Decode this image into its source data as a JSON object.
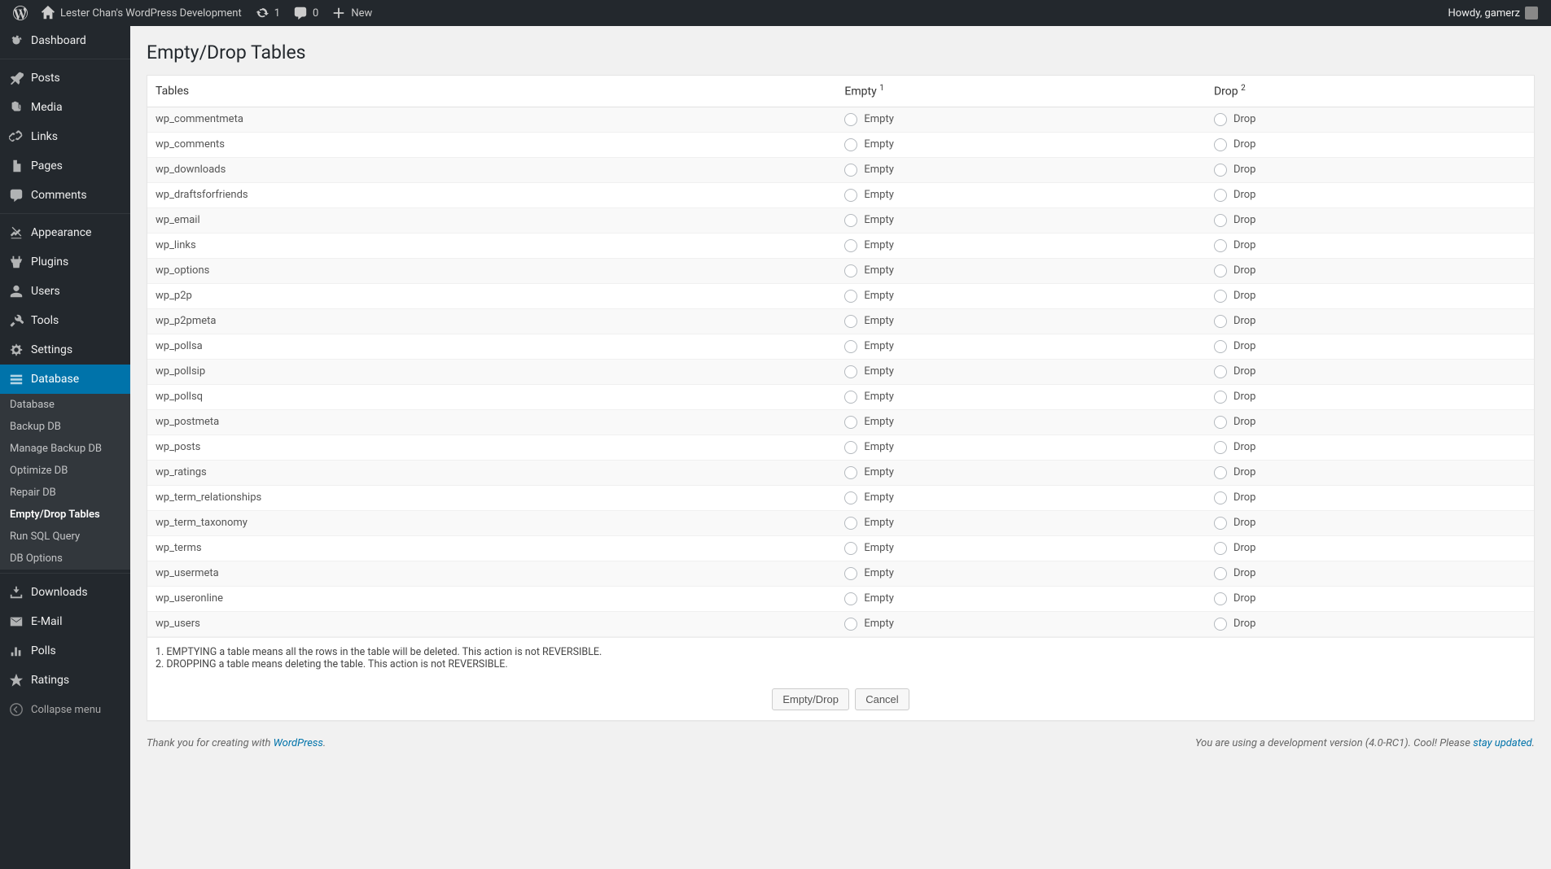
{
  "adminbar": {
    "site_title": "Lester Chan's WordPress Development",
    "updates_count": "1",
    "comments_count": "0",
    "new_label": "New",
    "howdy_label": "Howdy, gamerz"
  },
  "sidebar": {
    "items": [
      {
        "label": "Dashboard",
        "icon": "dashboard"
      },
      {
        "label": "Posts",
        "icon": "pin"
      },
      {
        "label": "Media",
        "icon": "media"
      },
      {
        "label": "Links",
        "icon": "link"
      },
      {
        "label": "Pages",
        "icon": "page"
      },
      {
        "label": "Comments",
        "icon": "comment"
      },
      {
        "label": "Appearance",
        "icon": "appearance"
      },
      {
        "label": "Plugins",
        "icon": "plugin"
      },
      {
        "label": "Users",
        "icon": "users"
      },
      {
        "label": "Tools",
        "icon": "tools"
      },
      {
        "label": "Settings",
        "icon": "settings"
      },
      {
        "label": "Database",
        "icon": "database",
        "current": true
      },
      {
        "label": "Downloads",
        "icon": "download"
      },
      {
        "label": "E-Mail",
        "icon": "email"
      },
      {
        "label": "Polls",
        "icon": "polls"
      },
      {
        "label": "Ratings",
        "icon": "ratings"
      }
    ],
    "submenu": [
      {
        "label": "Database"
      },
      {
        "label": "Backup DB"
      },
      {
        "label": "Manage Backup DB"
      },
      {
        "label": "Optimize DB"
      },
      {
        "label": "Repair DB"
      },
      {
        "label": "Empty/Drop Tables",
        "current": true
      },
      {
        "label": "Run SQL Query"
      },
      {
        "label": "DB Options"
      }
    ],
    "collapse_label": "Collapse menu"
  },
  "page": {
    "title": "Empty/Drop Tables",
    "col_tables": "Tables",
    "col_empty": "Empty",
    "col_empty_sup": "1",
    "col_drop": "Drop",
    "col_drop_sup": "2",
    "empty_label": "Empty",
    "drop_label": "Drop",
    "rows": [
      "wp_commentmeta",
      "wp_comments",
      "wp_downloads",
      "wp_draftsforfriends",
      "wp_email",
      "wp_links",
      "wp_options",
      "wp_p2p",
      "wp_p2pmeta",
      "wp_pollsa",
      "wp_pollsip",
      "wp_pollsq",
      "wp_postmeta",
      "wp_posts",
      "wp_ratings",
      "wp_term_relationships",
      "wp_term_taxonomy",
      "wp_terms",
      "wp_usermeta",
      "wp_useronline",
      "wp_users"
    ],
    "note1": "1. EMPTYING a table means all the rows in the table will be deleted. This action is not REVERSIBLE.",
    "note2": "2. DROPPING a table means deleting the table. This action is not REVERSIBLE.",
    "btn_submit": "Empty/Drop",
    "btn_cancel": "Cancel"
  },
  "footer": {
    "thank_prefix": "Thank you for creating with ",
    "wordpress_label": "WordPress",
    "thank_suffix": ".",
    "dev_prefix": "You are using a development version (4.0-RC1). Cool! Please ",
    "stay_updated": "stay updated",
    "dev_suffix": "."
  }
}
